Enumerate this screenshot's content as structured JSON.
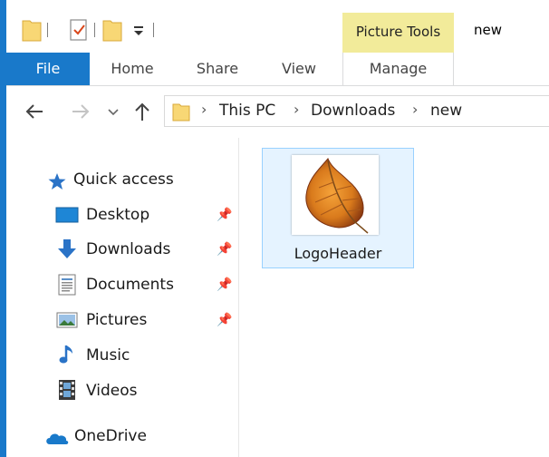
{
  "window": {
    "title": "new",
    "context_tab_group": "Picture Tools"
  },
  "ribbon": {
    "tabs": [
      {
        "label": "File"
      },
      {
        "label": "Home"
      },
      {
        "label": "Share"
      },
      {
        "label": "View"
      },
      {
        "label": "Manage"
      }
    ]
  },
  "address": {
    "crumbs": [
      "This PC",
      "Downloads",
      "new"
    ]
  },
  "nav_pane": {
    "quick_access": {
      "label": "Quick access"
    },
    "items": [
      {
        "label": "Desktop",
        "icon": "desktop-icon",
        "pinned": true
      },
      {
        "label": "Downloads",
        "icon": "download-arrow-icon",
        "pinned": true
      },
      {
        "label": "Documents",
        "icon": "document-icon",
        "pinned": true
      },
      {
        "label": "Pictures",
        "icon": "pictures-icon",
        "pinned": true
      },
      {
        "label": "Music",
        "icon": "music-note-icon",
        "pinned": false
      },
      {
        "label": "Videos",
        "icon": "film-icon",
        "pinned": false
      }
    ],
    "onedrive": {
      "label": "OneDrive"
    }
  },
  "files": [
    {
      "name": "LogoHeader",
      "type": "image",
      "selected": true
    }
  ],
  "colors": {
    "accent": "#1979ca",
    "context_tab": "#f2eb9a",
    "selection_fill": "#e5f3ff",
    "selection_border": "#99d1ff"
  }
}
